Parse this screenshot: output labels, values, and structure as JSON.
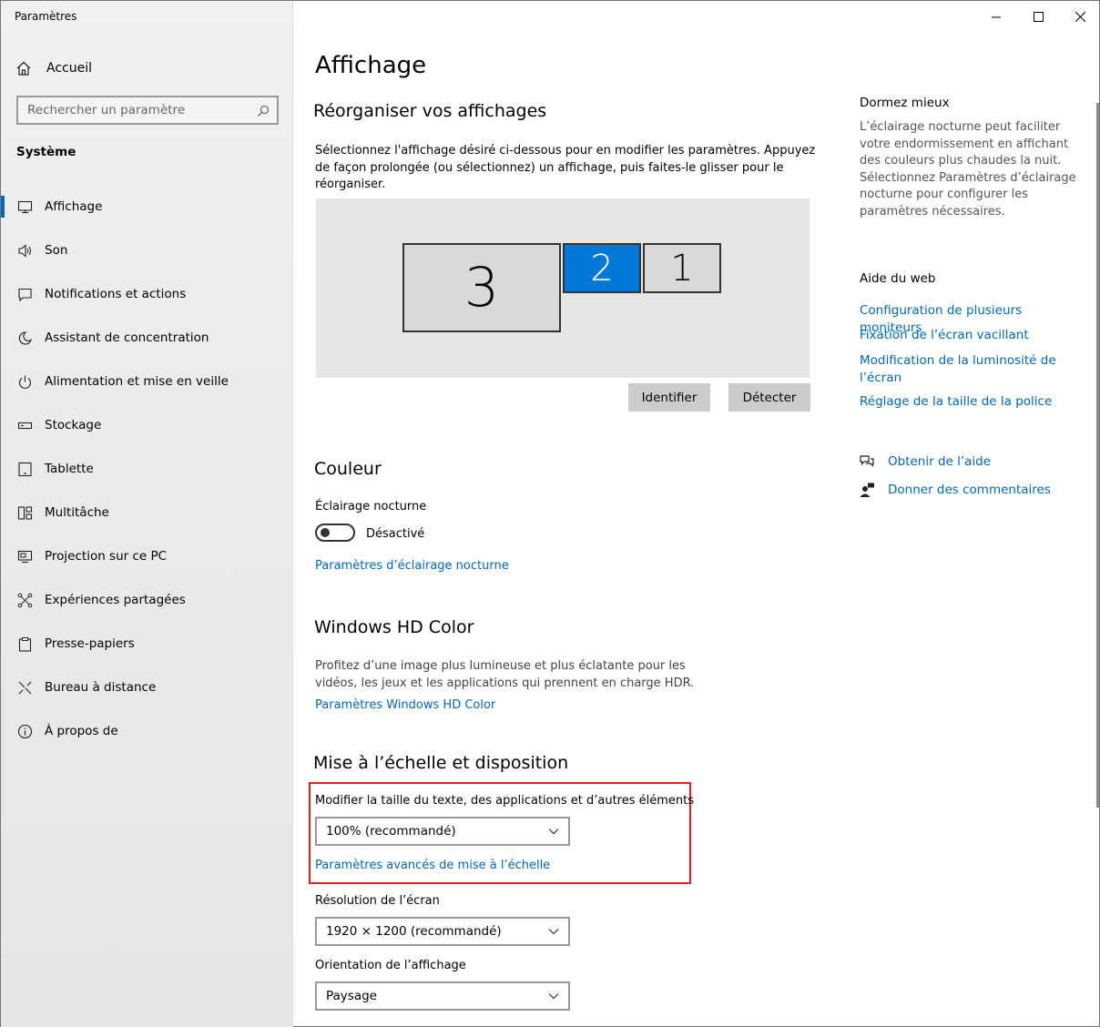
{
  "window": {
    "title": "Paramètres",
    "controls": [
      "minimize",
      "maximize",
      "close"
    ]
  },
  "sidebar": {
    "home_label": "Accueil",
    "search_placeholder": "Rechercher un paramètre",
    "section": "Système",
    "items": [
      {
        "label": "Affichage",
        "icon": "display-icon",
        "active": true
      },
      {
        "label": "Son",
        "icon": "speaker-icon"
      },
      {
        "label": "Notifications et actions",
        "icon": "notification-icon"
      },
      {
        "label": "Assistant de concentration",
        "icon": "moon-icon"
      },
      {
        "label": "Alimentation et mise en veille",
        "icon": "power-icon"
      },
      {
        "label": "Stockage",
        "icon": "storage-icon"
      },
      {
        "label": "Tablette",
        "icon": "tablet-icon"
      },
      {
        "label": "Multitâche",
        "icon": "multitask-icon"
      },
      {
        "label": "Projection sur ce PC",
        "icon": "projection-icon"
      },
      {
        "label": "Expériences partagées",
        "icon": "shared-icon"
      },
      {
        "label": "Presse-papiers",
        "icon": "clipboard-icon"
      },
      {
        "label": "Bureau à distance",
        "icon": "remote-desktop-icon"
      },
      {
        "label": "À propos de",
        "icon": "info-icon"
      }
    ]
  },
  "main": {
    "title": "Affichage",
    "rearrange": {
      "heading": "Réorganiser vos affichages",
      "description": "Sélectionnez l'affichage désiré ci-dessous pour en modifier les paramètres. Appuyez de façon prolongée (ou sélectionnez) un affichage, puis faites-le glisser pour le réorganiser.",
      "monitors": [
        {
          "number": "3",
          "selected": false
        },
        {
          "number": "2",
          "selected": true
        },
        {
          "number": "1",
          "selected": false
        }
      ],
      "identify_label": "Identifier",
      "detect_label": "Détecter"
    },
    "color": {
      "heading": "Couleur",
      "night_light_label": "Éclairage nocturne",
      "toggle_state": "Désactivé",
      "settings_link": "Paramètres d’éclairage nocturne"
    },
    "hdr": {
      "heading": "Windows HD Color",
      "description": "Profitez d’une image plus lumineuse et plus éclatante pour les vidéos, les jeux et les applications qui prennent en charge HDR.",
      "settings_link": "Paramètres Windows HD Color"
    },
    "scale": {
      "heading": "Mise à l’échelle et disposition",
      "size_label": "Modifier la taille du texte, des applications et d’autres éléments",
      "size_value": "100% (recommandé)",
      "advanced_link": "Paramètres avancés de mise à l’échelle",
      "resolution_label": "Résolution de l’écran",
      "resolution_value": "1920 × 1200 (recommandé)",
      "orientation_label": "Orientation de l’affichage",
      "orientation_value": "Paysage"
    }
  },
  "aside": {
    "sleep_heading": "Dormez mieux",
    "sleep_text": "L’éclairage nocturne peut faciliter votre endormissement en affichant des couleurs plus chaudes la nuit. Sélectionnez Paramètres d’éclairage nocturne pour configurer les paramètres nécessaires.",
    "web_heading": "Aide du web",
    "web_links": [
      "Configuration de plusieurs moniteurs",
      "Fixation de l’écran vacillant",
      "Modification de la luminosité de l’écran",
      "Réglage de la taille de la police"
    ],
    "get_help": "Obtenir de l’aide",
    "feedback": "Donner des commentaires"
  },
  "colors": {
    "accent": "#0078d7",
    "link": "#0067c0",
    "highlight_box": "#e31e24"
  }
}
